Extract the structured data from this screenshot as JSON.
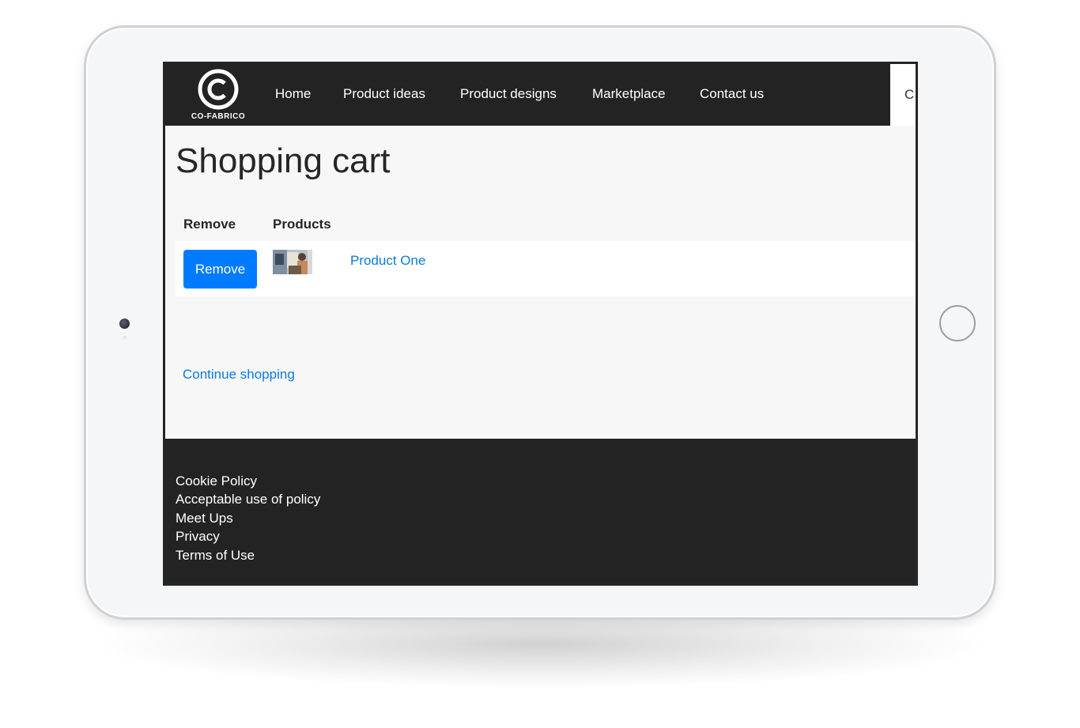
{
  "brand": {
    "name": "CO-FABRICO",
    "logo_icon": "copyright-c-logo-icon"
  },
  "nav": {
    "items": [
      {
        "label": "Home"
      },
      {
        "label": "Product ideas"
      },
      {
        "label": "Product designs"
      },
      {
        "label": "Marketplace"
      },
      {
        "label": "Contact us"
      }
    ],
    "overflow_fragment": "C"
  },
  "page": {
    "title": "Shopping cart"
  },
  "cart": {
    "columns": [
      "Remove",
      "Products"
    ],
    "rows": [
      {
        "remove_label": "Remove",
        "thumbnail_icon": "product-photo-thumbnail",
        "product_name": "Product One"
      }
    ]
  },
  "continue_label": "Continue shopping",
  "footer": {
    "links": [
      "Cookie Policy",
      "Acceptable use of policy",
      "Meet Ups",
      "Privacy",
      "Terms of Use"
    ]
  },
  "colors": {
    "navbar_bg": "#232323",
    "accent_button": "#007bff",
    "link": "#0a7bdc",
    "page_bg": "#f7f7f8"
  }
}
